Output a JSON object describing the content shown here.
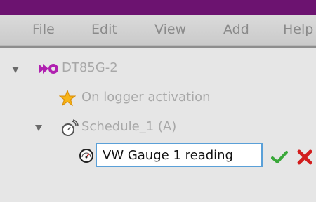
{
  "menu": {
    "items": [
      {
        "label": "File"
      },
      {
        "label": "Edit"
      },
      {
        "label": "View"
      },
      {
        "label": "Add"
      },
      {
        "label": "Help"
      }
    ]
  },
  "tree": {
    "logger": {
      "label": "DT85G-2",
      "icon": "logger-icon"
    },
    "activation": {
      "label": "On logger activation",
      "icon": "star-icon"
    },
    "schedule": {
      "label": "Schedule_1 (A)",
      "icon": "stopwatch-icon"
    },
    "channel": {
      "edit_value": "VW Gauge 1 reading",
      "icon": "gauge-icon",
      "accept_icon": "checkmark-icon",
      "cancel_icon": "cross-icon"
    }
  },
  "colors": {
    "titlebar": "#6c1370",
    "accent_magenta": "#b020b0",
    "accept_green": "#3aa83a",
    "cancel_red": "#d21c1c",
    "input_border": "#5aa0d8"
  }
}
